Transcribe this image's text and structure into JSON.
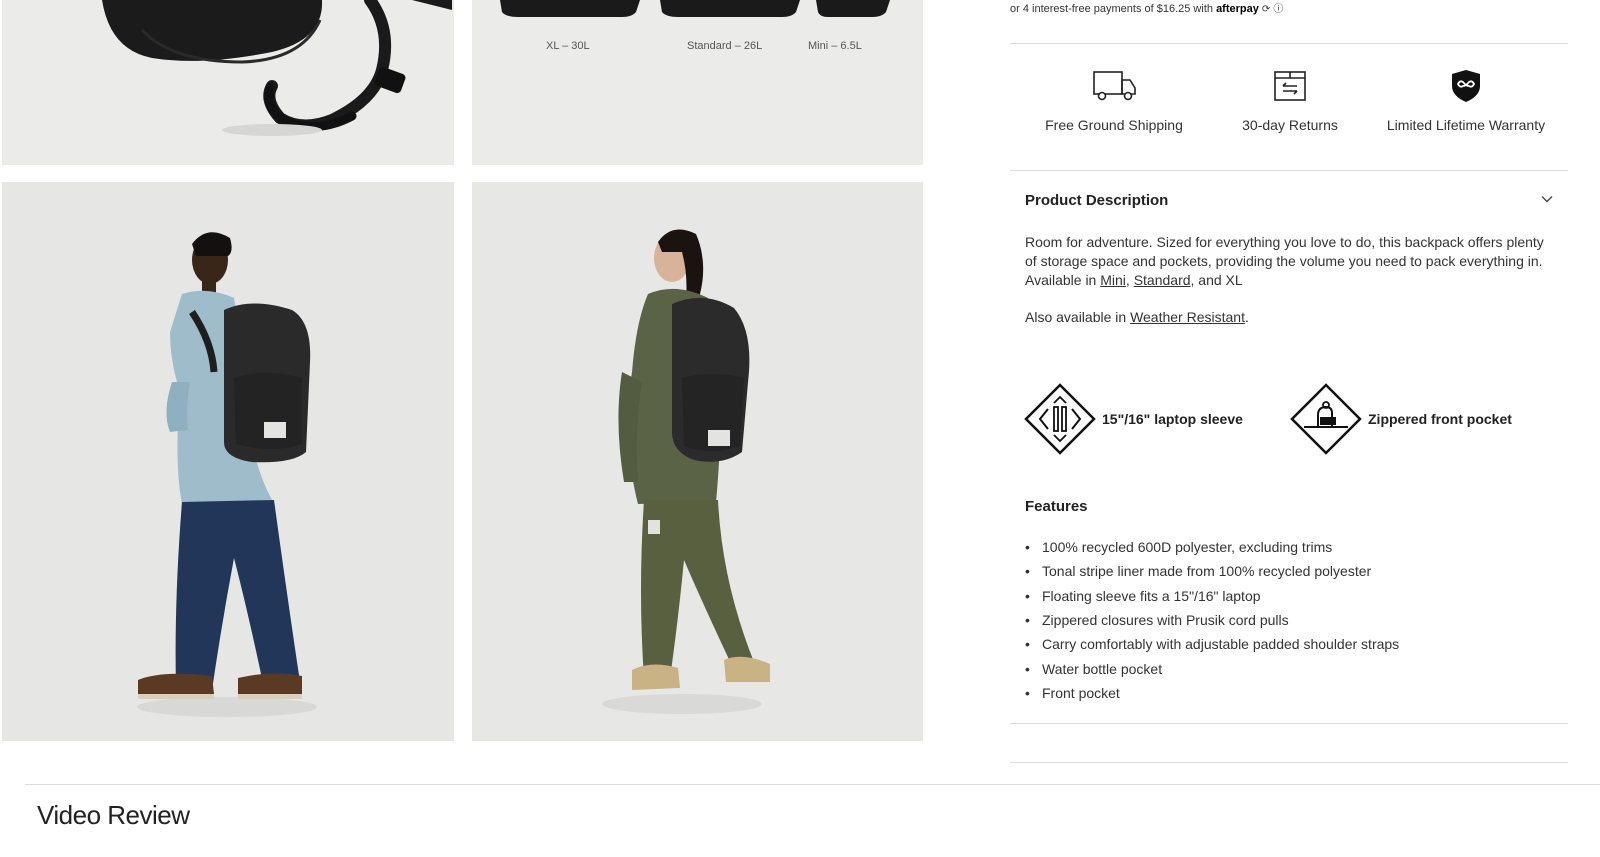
{
  "gallery": {
    "size_labels": [
      "XL – 30L",
      "Standard – 26L",
      "Mini – 6.5L"
    ]
  },
  "afterpay": {
    "text": "or 4 interest-free payments of $16.25 with",
    "brand": "afterpay",
    "info_glyph": "ⓘ"
  },
  "perks": [
    {
      "icon": "truck-icon",
      "label": "Free Ground Shipping"
    },
    {
      "icon": "returns-box-icon",
      "label": "30-day Returns"
    },
    {
      "icon": "warranty-shield-icon",
      "label": "Limited Lifetime Warranty"
    }
  ],
  "description": {
    "heading": "Product Description",
    "body": "Room for adventure. Sized for everything you love to do, this backpack offers plenty of storage space and pockets, providing the volume you need to pack everything in.",
    "available_prefix": "Available in ",
    "available_links": [
      "Mini",
      "Standard"
    ],
    "available_sep": ", ",
    "available_suffix": ", and XL",
    "also_prefix": "Also available in ",
    "also_link": "Weather Resistant",
    "also_suffix": "."
  },
  "feature_badges": [
    {
      "icon": "laptop-sleeve-icon",
      "label": "15\"/16\" laptop sleeve"
    },
    {
      "icon": "front-pocket-icon",
      "label": "Zippered front pocket"
    }
  ],
  "features": {
    "heading": "Features",
    "items": [
      "100% recycled 600D polyester, excluding trims",
      "Tonal stripe liner made from 100% recycled polyester",
      "Floating sleeve fits a 15\"/16\" laptop",
      "Zippered closures with Prusik cord pulls",
      "Carry comfortably with adjustable padded shoulder straps",
      "Water bottle pocket",
      "Front pocket"
    ]
  },
  "video_review": {
    "title": "Video Review"
  }
}
